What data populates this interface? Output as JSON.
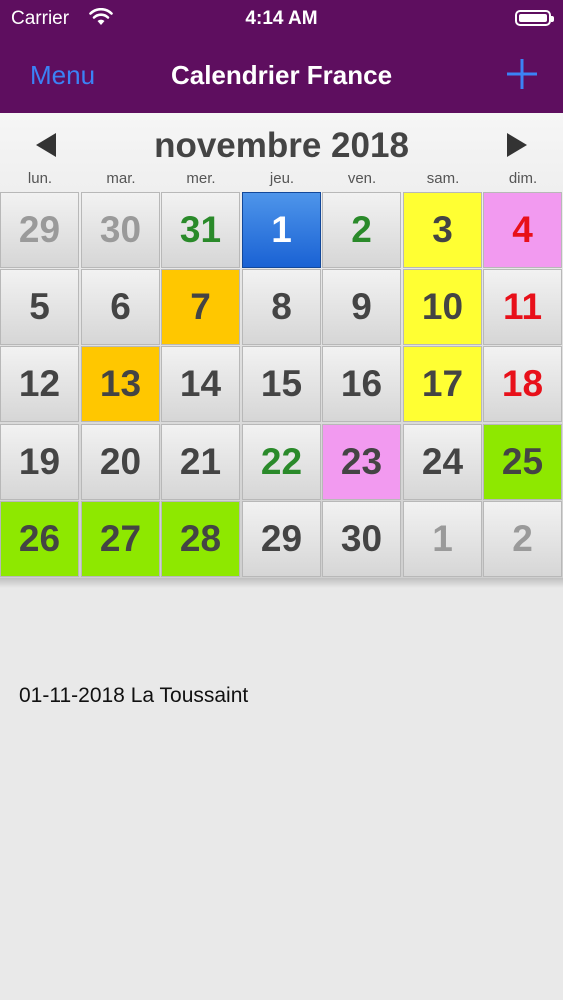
{
  "status_bar": {
    "carrier": "Carrier",
    "time": "4:14 AM"
  },
  "nav": {
    "menu_label": "Menu",
    "title": "Calendrier France"
  },
  "calendar": {
    "month_title": "novembre 2018",
    "weekdays": [
      "lun.",
      "mar.",
      "mer.",
      "jeu.",
      "ven.",
      "sam.",
      "dim."
    ],
    "days": [
      {
        "n": "29",
        "c": "gray"
      },
      {
        "n": "30",
        "c": "gray"
      },
      {
        "n": "31",
        "c": "green"
      },
      {
        "n": "1",
        "c": "white",
        "bg": "blue"
      },
      {
        "n": "2",
        "c": "green"
      },
      {
        "n": "3",
        "c": "dark",
        "bg": "yellow"
      },
      {
        "n": "4",
        "c": "red",
        "bg": "pink"
      },
      {
        "n": "5",
        "c": "dark"
      },
      {
        "n": "6",
        "c": "dark"
      },
      {
        "n": "7",
        "c": "dark",
        "bg": "orange"
      },
      {
        "n": "8",
        "c": "dark"
      },
      {
        "n": "9",
        "c": "dark"
      },
      {
        "n": "10",
        "c": "dark",
        "bg": "yellow"
      },
      {
        "n": "11",
        "c": "red"
      },
      {
        "n": "12",
        "c": "dark"
      },
      {
        "n": "13",
        "c": "dark",
        "bg": "orange"
      },
      {
        "n": "14",
        "c": "dark"
      },
      {
        "n": "15",
        "c": "dark"
      },
      {
        "n": "16",
        "c": "dark"
      },
      {
        "n": "17",
        "c": "dark",
        "bg": "yellow"
      },
      {
        "n": "18",
        "c": "red"
      },
      {
        "n": "19",
        "c": "dark"
      },
      {
        "n": "20",
        "c": "dark"
      },
      {
        "n": "21",
        "c": "dark"
      },
      {
        "n": "22",
        "c": "green"
      },
      {
        "n": "23",
        "c": "dark",
        "bg": "pink"
      },
      {
        "n": "24",
        "c": "dark"
      },
      {
        "n": "25",
        "c": "dark",
        "bg": "lime"
      },
      {
        "n": "26",
        "c": "dark",
        "bg": "lime"
      },
      {
        "n": "27",
        "c": "dark",
        "bg": "lime"
      },
      {
        "n": "28",
        "c": "dark",
        "bg": "lime"
      },
      {
        "n": "29",
        "c": "dark"
      },
      {
        "n": "30",
        "c": "dark"
      },
      {
        "n": "1",
        "c": "gray"
      },
      {
        "n": "2",
        "c": "gray"
      }
    ]
  },
  "event": {
    "text": "01-11-2018 La Toussaint"
  }
}
